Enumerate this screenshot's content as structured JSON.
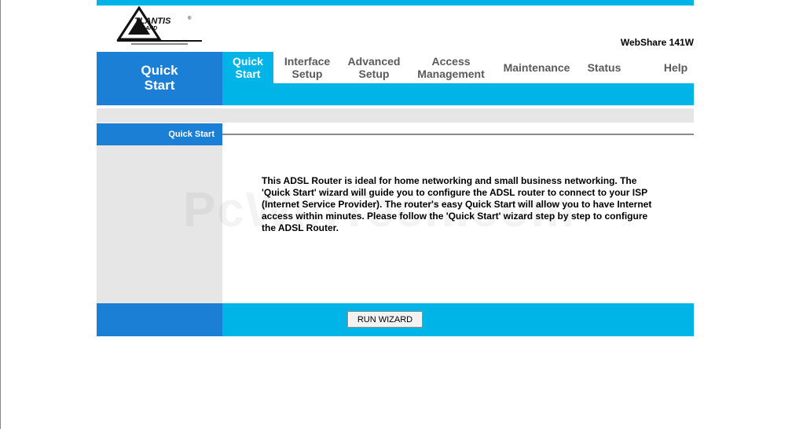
{
  "header": {
    "logo_text": "ATLANTIS LAND",
    "model": "WebShare 141W"
  },
  "nav": {
    "section_title_line1": "Quick",
    "section_title_line2": "Start",
    "items": [
      {
        "line1": "Quick",
        "line2": "Start",
        "active": true
      },
      {
        "line1": "Interface",
        "line2": "Setup",
        "active": false
      },
      {
        "line1": "Advanced",
        "line2": "Setup",
        "active": false
      },
      {
        "line1": "Access",
        "line2": "Management",
        "active": false
      },
      {
        "line1": "Maintenance",
        "line2": "",
        "active": false
      },
      {
        "line1": "Status",
        "line2": "",
        "active": false
      },
      {
        "line1": "Help",
        "line2": "",
        "active": false
      }
    ]
  },
  "section": {
    "label": "Quick Start"
  },
  "content": {
    "description": "This ADSL Router is ideal for home networking and small business networking. The 'Quick Start' wizard will guide you to configure the ADSL router to connect to your ISP (Internet Service Provider). The router's easy Quick Start will allow you to have Internet access within minutes. Please follow the 'Quick Start' wizard step by step to configure the ADSL Router.",
    "watermark": "PcWinTech.com"
  },
  "actions": {
    "run_wizard_label": "RUN WIZARD"
  },
  "colors": {
    "accent_cyan": "#00b4e8",
    "accent_blue": "#1b7fd6",
    "panel_gray": "#e6e6e6"
  }
}
